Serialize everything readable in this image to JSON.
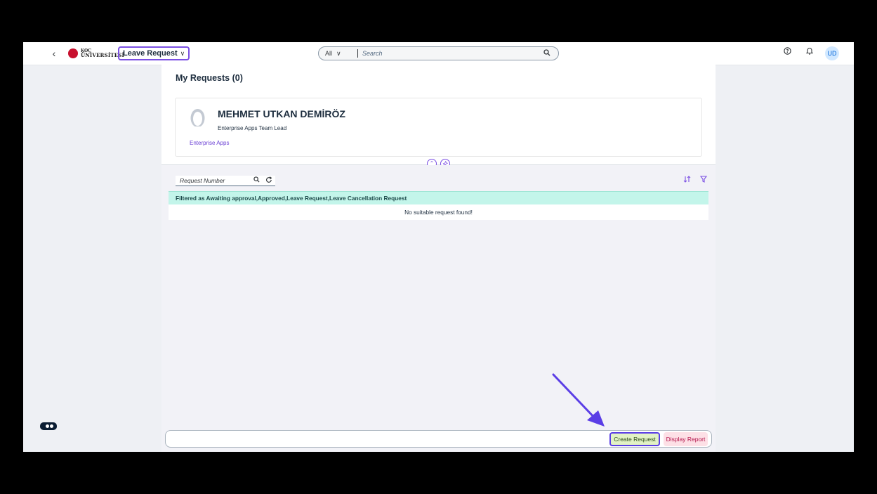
{
  "shell": {
    "back_icon": "chevron-left-icon",
    "logo_line1": "KOÇ",
    "logo_line2": "ÜNİVERSİTESİ",
    "app_title": "Leave Request",
    "search_scope": "All",
    "search_placeholder": "Search",
    "avatar_initials": "UD"
  },
  "page": {
    "title": "My Requests (0)",
    "profile": {
      "name": "MEHMET UTKAN DEMİRÖZ",
      "role": "Enterprise Apps Team Lead",
      "department": "Enterprise Apps"
    },
    "toolbar": {
      "search_placeholder": "Request Number"
    },
    "table": {
      "filter_text": "Filtered as Awaiting approval,Approved,Leave Request,Leave Cancellation Request",
      "empty_text": "No suitable request found!"
    },
    "footer": {
      "create_label": "Create Request",
      "report_label": "Display Report"
    }
  },
  "colors": {
    "accent": "#7b4fe3",
    "create_bg": "#e2f2c5",
    "report_bg": "#fde0e6",
    "filter_bg": "#c3f5ea",
    "arrow": "#5b3ee6"
  }
}
